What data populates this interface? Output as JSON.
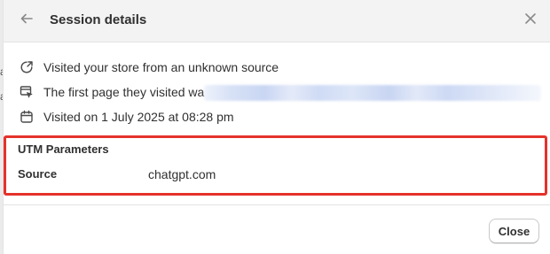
{
  "backdrop": {
    "edge_chars": [
      "a",
      "a"
    ]
  },
  "modal": {
    "title": "Session details",
    "icons": {
      "back": "arrow-left-icon",
      "close": "close-icon"
    },
    "rows": [
      {
        "icon": "referral-source-icon",
        "text": "Visited your store from an unknown source"
      },
      {
        "icon": "landing-page-icon",
        "text": "The first page they visited wa"
      },
      {
        "icon": "calendar-icon",
        "text": "Visited on 1 July 2025 at 08:28 pm"
      }
    ],
    "utm": {
      "title": "UTM Parameters",
      "source_label": "Source",
      "source_value": "chatgpt.com"
    },
    "footer": {
      "close_label": "Close"
    }
  },
  "colors": {
    "highlight_border": "#e4322b",
    "header_bg": "#f3f3f3",
    "text": "#303030"
  }
}
